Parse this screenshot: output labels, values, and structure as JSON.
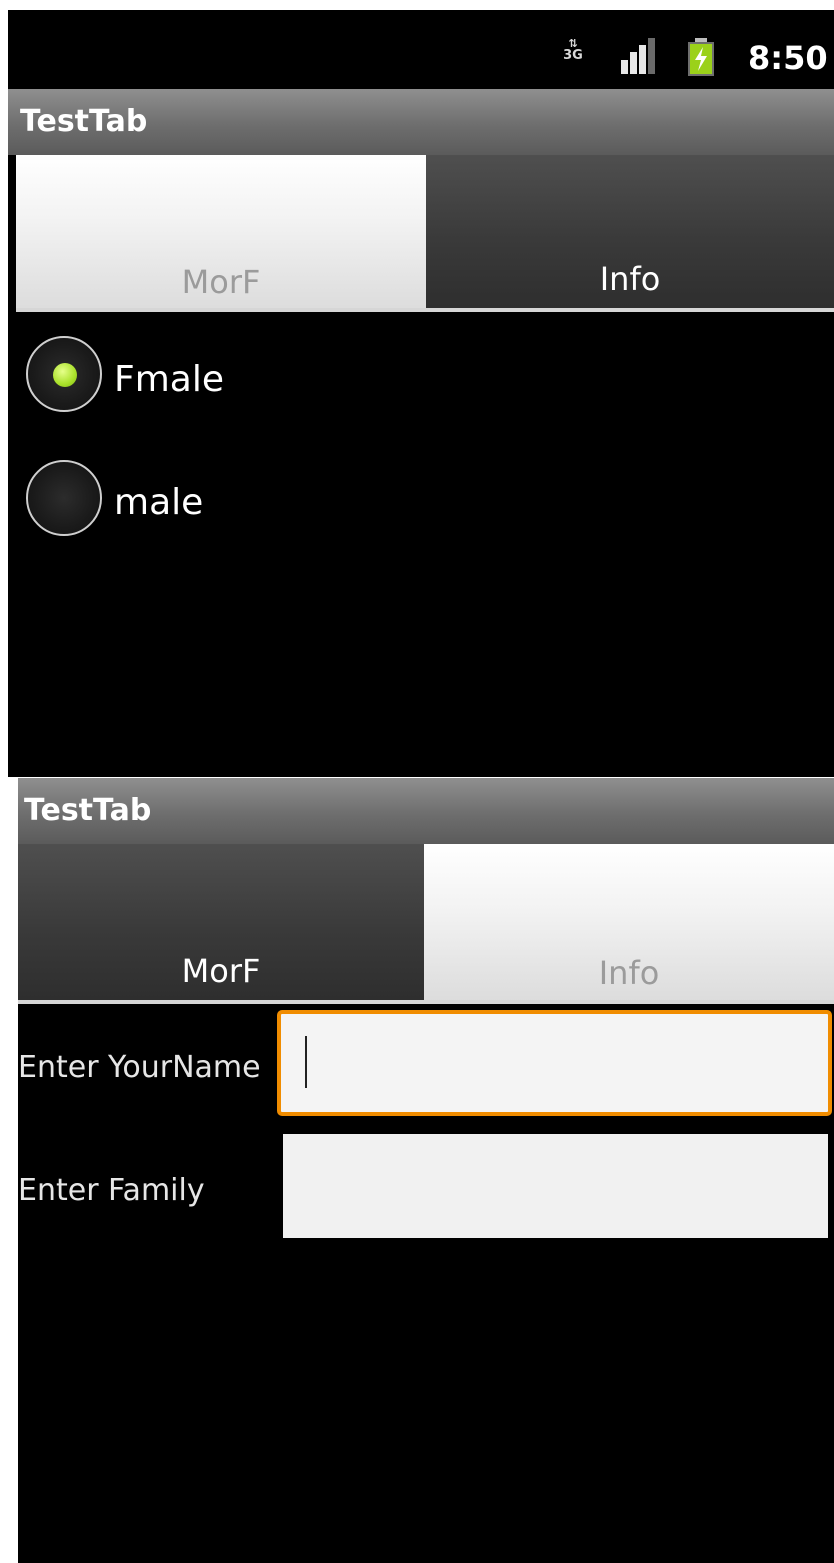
{
  "screen1": {
    "status_bar": {
      "network_label": "3G",
      "time": "8:50"
    },
    "title": "TestTab",
    "tabs": [
      {
        "label": "MorF",
        "selected": true
      },
      {
        "label": "Info",
        "selected": false
      }
    ],
    "radio_options": [
      {
        "label": "Fmale",
        "checked": true
      },
      {
        "label": "male",
        "checked": false
      }
    ]
  },
  "screen2": {
    "title": "TestTab",
    "tabs": [
      {
        "label": "MorF",
        "selected": false
      },
      {
        "label": "Info",
        "selected": true
      }
    ],
    "fields": [
      {
        "label": "Enter YourName",
        "value": "",
        "focused": true
      },
      {
        "label": "Enter Family",
        "value": "",
        "focused": false
      }
    ]
  },
  "colors": {
    "radio_checked": "#a9e12a",
    "focus_border": "#f08c00"
  }
}
